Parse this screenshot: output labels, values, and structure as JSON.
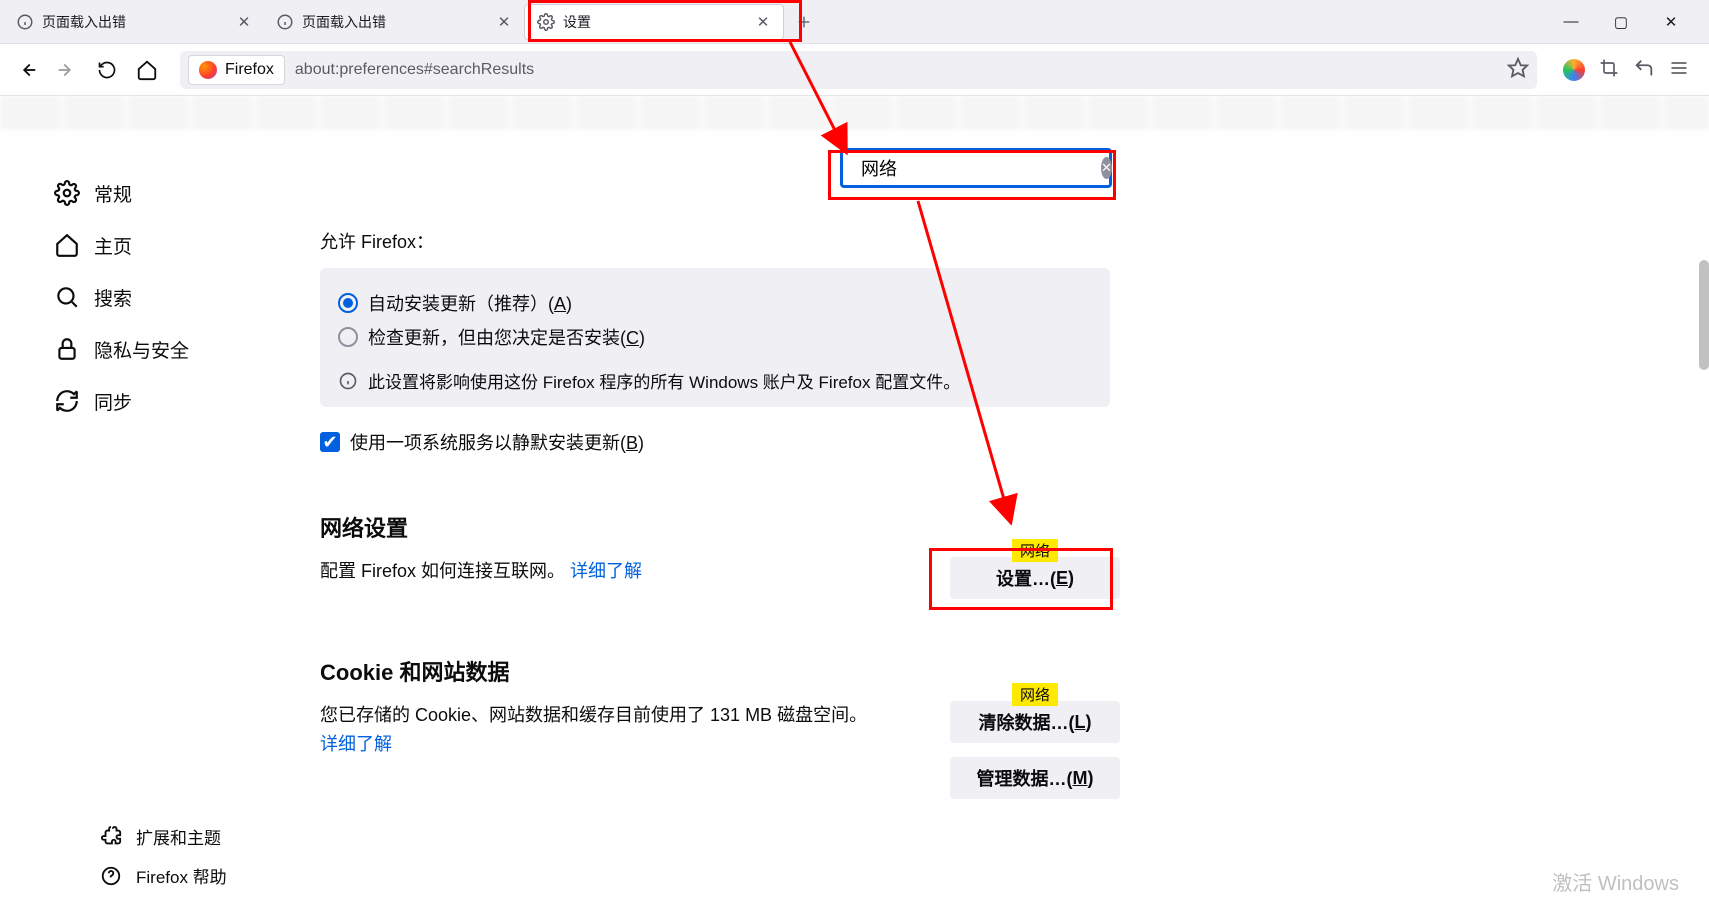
{
  "tabs": [
    {
      "title": "页面载入出错"
    },
    {
      "title": "页面载入出错"
    },
    {
      "title": "设置"
    }
  ],
  "toolbar": {
    "identity_label": "Firefox",
    "url": "about:preferences#searchResults"
  },
  "sidebar": {
    "items": [
      {
        "label": "常规"
      },
      {
        "label": "主页"
      },
      {
        "label": "搜索"
      },
      {
        "label": "隐私与安全"
      },
      {
        "label": "同步"
      }
    ],
    "bottom": {
      "ext": "扩展和主题",
      "help": "Firefox 帮助"
    }
  },
  "search": {
    "value": "网络"
  },
  "updates": {
    "allow_label": "允许 Firefox：",
    "opt_auto": "自动安装更新（推荐）(",
    "opt_auto_key": "A",
    "opt_check": "检查更新，但由您决定是否安装(",
    "opt_check_key": "C",
    "info": "此设置将影响使用这份 Firefox 程序的所有 Windows 账户及 Firefox 配置文件。",
    "bg_service": "使用一项系统服务以静默安装更新(",
    "bg_service_key": "B"
  },
  "network": {
    "heading": "网络设置",
    "desc_prefix": "配置 Firefox 如何连接互联网。 ",
    "learn_more": "详细了解",
    "tag": "网络",
    "settings_btn": "设置…(",
    "settings_key": "E"
  },
  "cookies": {
    "heading": "Cookie 和网站数据",
    "desc": "您已存储的 Cookie、网站数据和缓存目前使用了 131 MB 磁盘空间。",
    "learn_more": "详细了解",
    "tag": "网络",
    "clear_btn": "清除数据…(",
    "clear_key": "L",
    "manage_btn": "管理数据…(",
    "manage_key": "M"
  },
  "watermark": "激活 Windows"
}
